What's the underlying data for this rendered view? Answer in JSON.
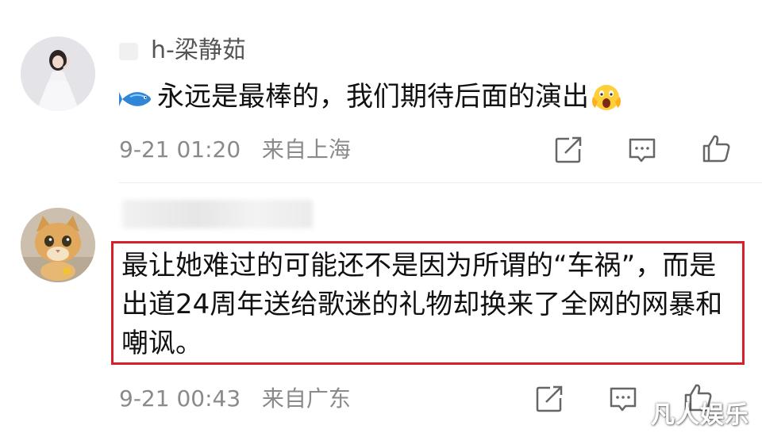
{
  "comments": [
    {
      "username": "h-梁静茹",
      "text": "永远是最棒的，我们期待后面的演出",
      "emoji_before": "fish-emoji",
      "emoji_after": "screaming-face-emoji",
      "timestamp": "9-21 01:20",
      "location": "来自上海",
      "actions": [
        "share-icon",
        "comment-icon",
        "like-icon"
      ]
    },
    {
      "username": "",
      "text": "最让她难过的可能还不是因为所谓的“车祸”，而是出道24周年送给歌迷的礼物却换来了全网的网暴和嘲讽。",
      "timestamp": "9-21 00:43",
      "location": "来自广东",
      "highlight_color": "#d8202a",
      "actions": [
        "share-icon",
        "comment-icon",
        "like-icon"
      ]
    }
  ],
  "watermark": "凡人娱乐",
  "colors": {
    "meta_text": "#8a8a8a",
    "body_text": "#111111",
    "highlight": "#d8202a",
    "divider": "#ececec"
  }
}
